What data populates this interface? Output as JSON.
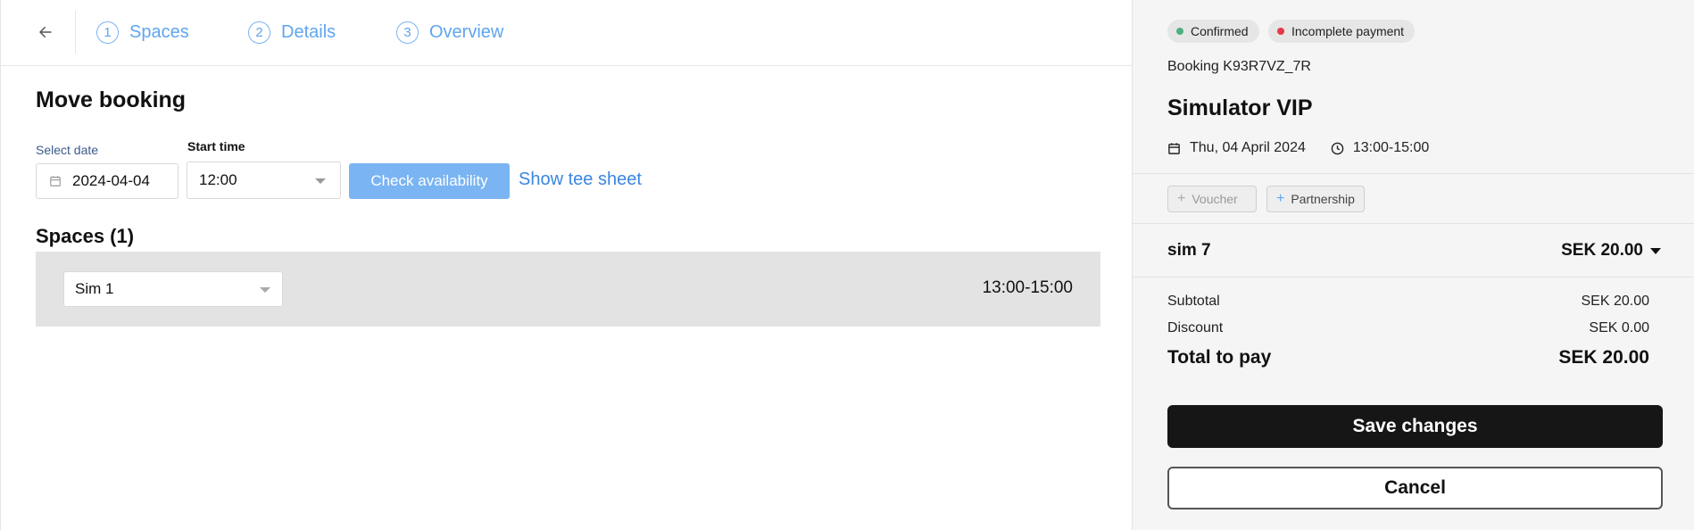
{
  "stepper": {
    "steps": [
      {
        "num": "1",
        "label": "Spaces"
      },
      {
        "num": "2",
        "label": "Details"
      },
      {
        "num": "3",
        "label": "Overview"
      }
    ]
  },
  "main": {
    "title": "Move booking",
    "date_label": "Select date",
    "date_value": "2024-04-04",
    "time_label": "Start time",
    "time_value": "12:00",
    "check_button": "Check availability",
    "tee_sheet_link": "Show tee sheet",
    "spaces_heading": "Spaces (1)",
    "spaces": [
      {
        "selected": "Sim 1",
        "time": "13:00-15:00"
      }
    ]
  },
  "sidebar": {
    "badges": [
      {
        "label": "Confirmed",
        "dot_color": "#4caf82"
      },
      {
        "label": "Incomplete payment",
        "dot_color": "#e5394a"
      }
    ],
    "booking_id": "Booking K93R7VZ_7R",
    "booking_name": "Simulator VIP",
    "date": "Thu, 04 April 2024",
    "time": "13:00-15:00",
    "chips": {
      "voucher": "Voucher",
      "partnership": "Partnership"
    },
    "line_item": {
      "name": "sim 7",
      "price": "SEK 20.00"
    },
    "summary": {
      "subtotal_label": "Subtotal",
      "subtotal_value": "SEK 20.00",
      "discount_label": "Discount",
      "discount_value": "SEK 0.00",
      "total_label": "Total to pay",
      "total_value": "SEK 20.00"
    },
    "save_button": "Save changes",
    "cancel_button": "Cancel"
  },
  "colors": {
    "accent": "#5fa5ef",
    "check_button_bg": "#7ab4f2",
    "link": "#3a86e0",
    "primary_button": "#161616",
    "sidebar_bg": "#f5f5f5",
    "space_row_bg": "#e3e3e3"
  },
  "icons": [
    "back-arrow-icon",
    "calendar-icon",
    "clock-icon",
    "chevron-down-icon",
    "plus-icon"
  ]
}
